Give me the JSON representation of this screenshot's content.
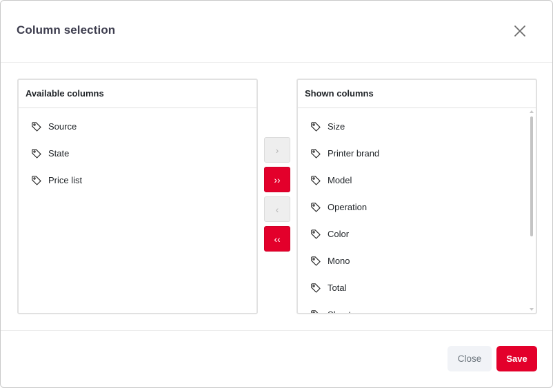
{
  "dialog": {
    "title": "Column selection"
  },
  "available": {
    "header": "Available columns",
    "items": [
      "Source",
      "State",
      "Price list"
    ]
  },
  "shown": {
    "header": "Shown columns",
    "items": [
      "Size",
      "Printer brand",
      "Model",
      "Operation",
      "Color",
      "Mono",
      "Total",
      "Sheets"
    ]
  },
  "transfer": {
    "move_right": "›",
    "move_all_right": "››",
    "move_left": "‹",
    "move_all_left": "‹‹"
  },
  "footer": {
    "close_label": "Close",
    "save_label": "Save"
  },
  "colors": {
    "accent": "#e3002b",
    "disabled_bg": "#eeeeee",
    "close_bg": "#f1f3f7"
  },
  "icons": {
    "dialog_close": "close-icon",
    "list_item": "tag-icon"
  }
}
